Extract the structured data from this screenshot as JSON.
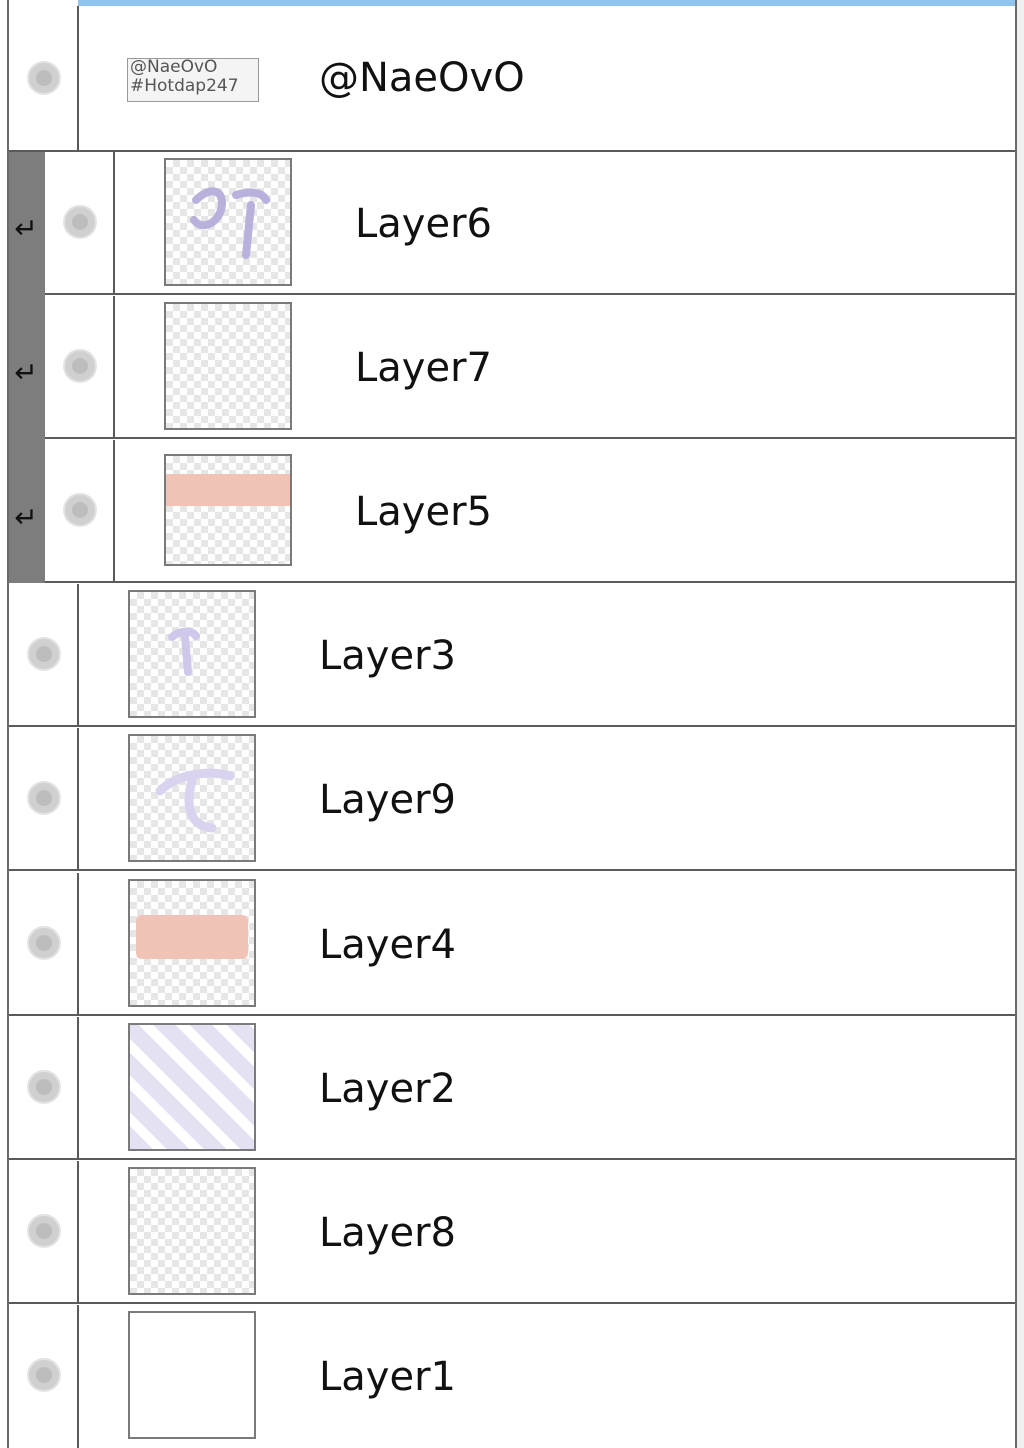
{
  "layers": [
    {
      "name": "@NaeOvO",
      "thumb_text": [
        "@NaeOvO",
        "#Hotdap247"
      ],
      "clipped": false
    },
    {
      "name": "Layer6",
      "clipped": true
    },
    {
      "name": "Layer7",
      "clipped": true
    },
    {
      "name": "Layer5",
      "clipped": true
    },
    {
      "name": "Layer3",
      "clipped": false
    },
    {
      "name": "Layer9",
      "clipped": false
    },
    {
      "name": "Layer4",
      "clipped": false
    },
    {
      "name": "Layer2",
      "clipped": false
    },
    {
      "name": "Layer8",
      "clipped": false
    },
    {
      "name": "Layer1",
      "clipped": false
    }
  ],
  "icons": {
    "visibility": "eye-toggle-icon",
    "clipping": "clipping-arrow-icon"
  },
  "colors": {
    "selection_bar": "#8fc4ee",
    "clip_strip": "#7d7d7d",
    "lavender": "#b9b0dc",
    "peach": "#f1c2b6"
  }
}
